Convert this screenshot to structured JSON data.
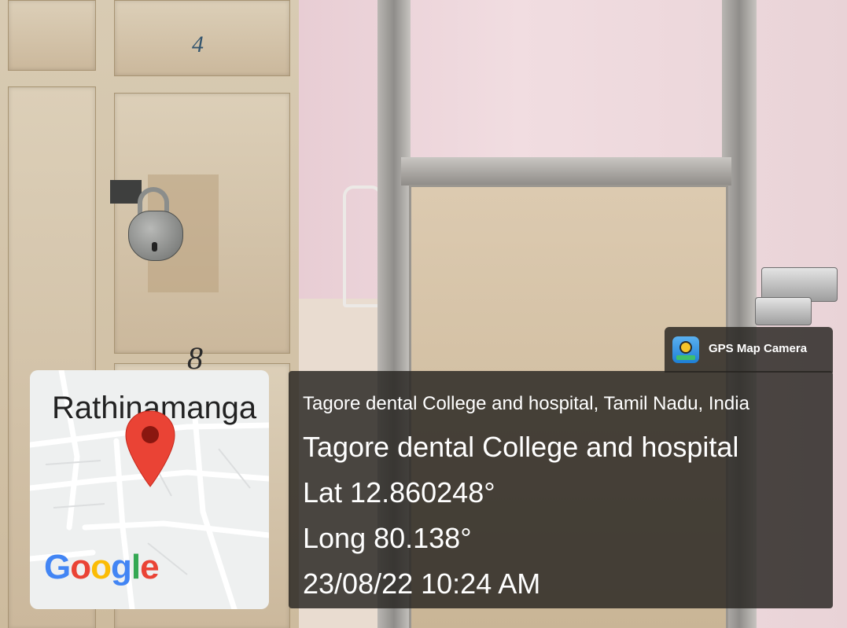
{
  "photo": {
    "locker_numbers": [
      "4",
      "8"
    ]
  },
  "map": {
    "place_label": "Rathinamanga",
    "provider": "Google",
    "provider_letters": [
      "G",
      "o",
      "o",
      "g",
      "l",
      "e"
    ],
    "provider_colors": [
      "#4285F4",
      "#EA4335",
      "#FBBC05",
      "#4285F4",
      "#34A853",
      "#EA4335"
    ],
    "pin_color": "#EA4335",
    "pin_icon": "location-pin-icon"
  },
  "badge": {
    "app_name": "GPS Map Camera",
    "icon": "gps-map-camera-app-icon"
  },
  "info": {
    "address": "Tagore dental College and hospital, Tamil Nadu, India",
    "place_name": "Tagore dental College and hospital",
    "latitude": "Lat 12.860248°",
    "longitude": "Long 80.138°",
    "datetime": "23/08/22 10:24 AM"
  }
}
